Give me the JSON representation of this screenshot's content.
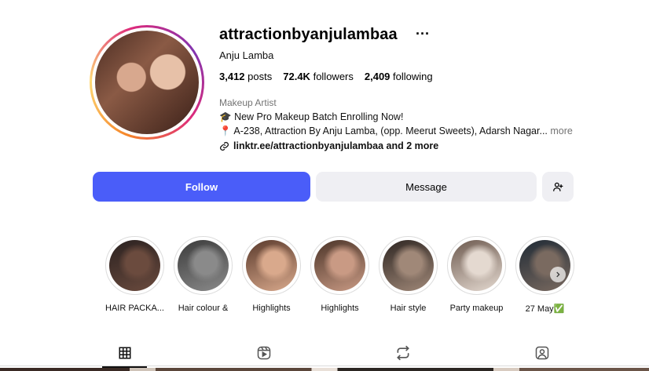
{
  "profile": {
    "username": "attractionbyanjulambaa",
    "more_label": "···",
    "full_name": "Anju Lamba",
    "posts_count": "3,412",
    "posts_label": "posts",
    "followers_count": "72.4K",
    "followers_label": "followers",
    "following_count": "2,409",
    "following_label": "following",
    "category": "Makeup Artist",
    "bio_line1_emoji": "🎓",
    "bio_line1": "New Pro Makeup Batch Enrolling Now!",
    "bio_line2_emoji": "📍",
    "bio_line2": "A-238, Attraction By Anju Lamba, (opp. Meerut Sweets), Adarsh Nagar...",
    "bio_more": "more",
    "link_text": "linktr.ee/attractionbyanjulambaa and 2 more"
  },
  "actions": {
    "follow_label": "Follow",
    "message_label": "Message",
    "add_user_icon": "add-person-icon"
  },
  "highlights": [
    {
      "label": "HAIR PACKA...",
      "colors": [
        "#2a2120",
        "#6b4b3e"
      ]
    },
    {
      "label": "Hair colour &",
      "colors": [
        "#3b3b3b",
        "#8a8a8a"
      ]
    },
    {
      "label": "Highlights",
      "colors": [
        "#5a3a2c",
        "#d9a98c"
      ]
    },
    {
      "label": "Highlights",
      "colors": [
        "#4b3428",
        "#c99a84"
      ]
    },
    {
      "label": "Hair style",
      "colors": [
        "#2e2622",
        "#a08878"
      ]
    },
    {
      "label": "Party makeup",
      "colors": [
        "#6d5a4f",
        "#e4d9d0"
      ]
    },
    {
      "label": "27 May✅",
      "colors": [
        "#1f2a35",
        "#7a6a60"
      ]
    }
  ],
  "tabs": [
    {
      "name": "posts",
      "icon": "grid-icon",
      "active": true
    },
    {
      "name": "reels",
      "icon": "reels-icon",
      "active": false
    },
    {
      "name": "reposts",
      "icon": "repost-icon",
      "active": false
    },
    {
      "name": "tagged",
      "icon": "tagged-icon",
      "active": false
    }
  ],
  "colors": {
    "follow_button": "#4a5df9",
    "secondary_button": "#efeff3",
    "muted_text": "#737373"
  }
}
